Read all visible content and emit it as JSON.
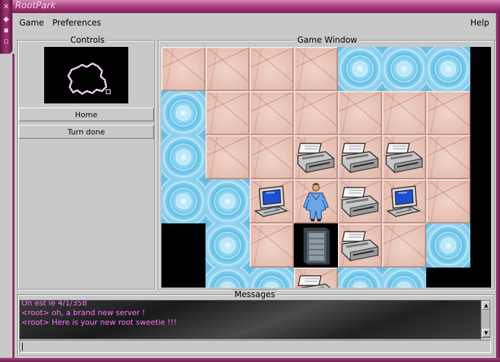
{
  "window": {
    "title": "RootPark"
  },
  "menu": {
    "game": "Game",
    "preferences": "Preferences",
    "help": "Help"
  },
  "controls": {
    "label": "Controls",
    "home_button": "Home",
    "turn_done_button": "Turn done"
  },
  "game": {
    "label": "Game Window"
  },
  "messages": {
    "label": "Messages",
    "lines": [
      "On est le 4/1/358",
      "<root> oh, a brand new server !",
      "<root> Here is your new root sweetie !!!"
    ],
    "input_value": ""
  },
  "board": {
    "rows": [
      [
        "flesh",
        "flesh",
        "flesh",
        "flesh",
        "ice",
        "ice",
        "ice"
      ],
      [
        "ice",
        "flesh",
        "flesh",
        "flesh",
        "flesh",
        "flesh",
        "flesh"
      ],
      [
        "ice",
        "flesh",
        "flesh",
        "flesh",
        "flesh",
        "flesh",
        "flesh"
      ],
      [
        "ice",
        "ice",
        "flesh",
        "flesh",
        "flesh",
        "flesh",
        "flesh"
      ],
      [
        "black",
        "ice",
        "flesh",
        "black",
        "flesh",
        "flesh",
        "ice"
      ],
      [
        "black",
        "ice",
        "ice",
        "flesh",
        "ice",
        "ice",
        "black"
      ]
    ],
    "objects": [
      {
        "row": 2,
        "col": 3,
        "kind": "printer-icon"
      },
      {
        "row": 2,
        "col": 4,
        "kind": "printer-icon"
      },
      {
        "row": 2,
        "col": 5,
        "kind": "printer-icon"
      },
      {
        "row": 3,
        "col": 2,
        "kind": "computer-icon"
      },
      {
        "row": 3,
        "col": 3,
        "kind": "root-character-icon"
      },
      {
        "row": 3,
        "col": 4,
        "kind": "printer-icon"
      },
      {
        "row": 3,
        "col": 5,
        "kind": "computer-icon"
      },
      {
        "row": 4,
        "col": 3,
        "kind": "server-rack-icon"
      },
      {
        "row": 4,
        "col": 4,
        "kind": "printer-icon"
      },
      {
        "row": 5,
        "col": 3,
        "kind": "printer-icon"
      }
    ]
  },
  "colors": {
    "title_bar": "#b04383",
    "message_text": "#ff74ff",
    "frame": "#8e2c66"
  }
}
